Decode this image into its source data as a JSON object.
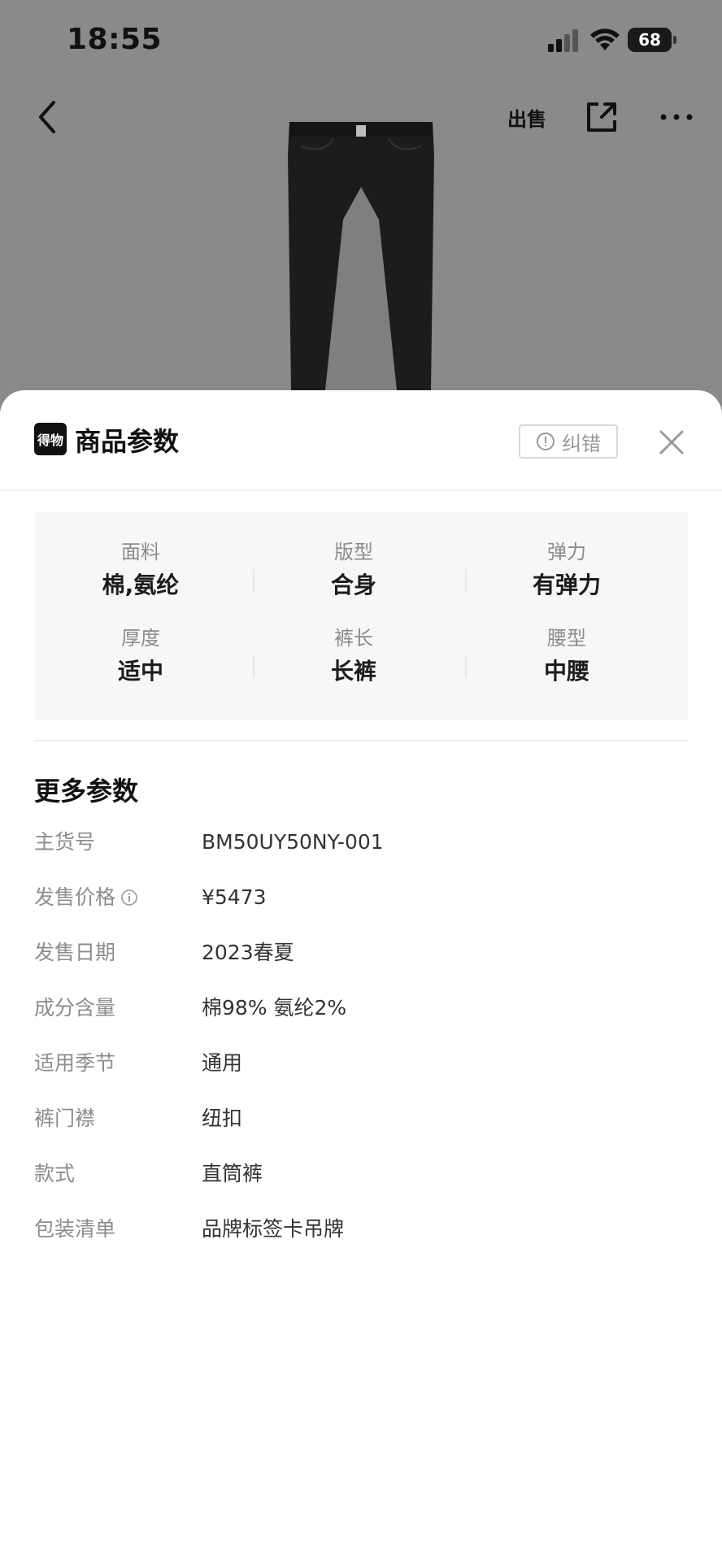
{
  "status_bar": {
    "time": "18:55",
    "battery": "68"
  },
  "nav": {
    "sell_label": "出售"
  },
  "sheet": {
    "logo_text": "得物",
    "title": "商品参数",
    "report_label": "纠错"
  },
  "summary": [
    {
      "label": "面料",
      "value": "棉,氨纶"
    },
    {
      "label": "版型",
      "value": "合身"
    },
    {
      "label": "弹力",
      "value": "有弹力"
    },
    {
      "label": "厚度",
      "value": "适中"
    },
    {
      "label": "裤长",
      "value": "长裤"
    },
    {
      "label": "腰型",
      "value": "中腰"
    }
  ],
  "more_params": {
    "title": "更多参数",
    "rows": [
      {
        "key": "主货号",
        "value": "BM50UY50NY-001"
      },
      {
        "key": "发售价格",
        "value": "¥5473"
      },
      {
        "key": "发售日期",
        "value": "2023春夏"
      },
      {
        "key": "成分含量",
        "value": "棉98% 氨纶2%"
      },
      {
        "key": "适用季节",
        "value": "通用"
      },
      {
        "key": "裤门襟",
        "value": "纽扣"
      },
      {
        "key": "款式",
        "value": "直筒裤"
      },
      {
        "key": "包装清单",
        "value": "品牌标签卡吊牌"
      }
    ]
  },
  "colors": {
    "overlay_bg": "#808080",
    "sheet_bg": "#ffffff",
    "summary_bg": "#f7f7f9",
    "label_gray": "#8c8c8c"
  }
}
